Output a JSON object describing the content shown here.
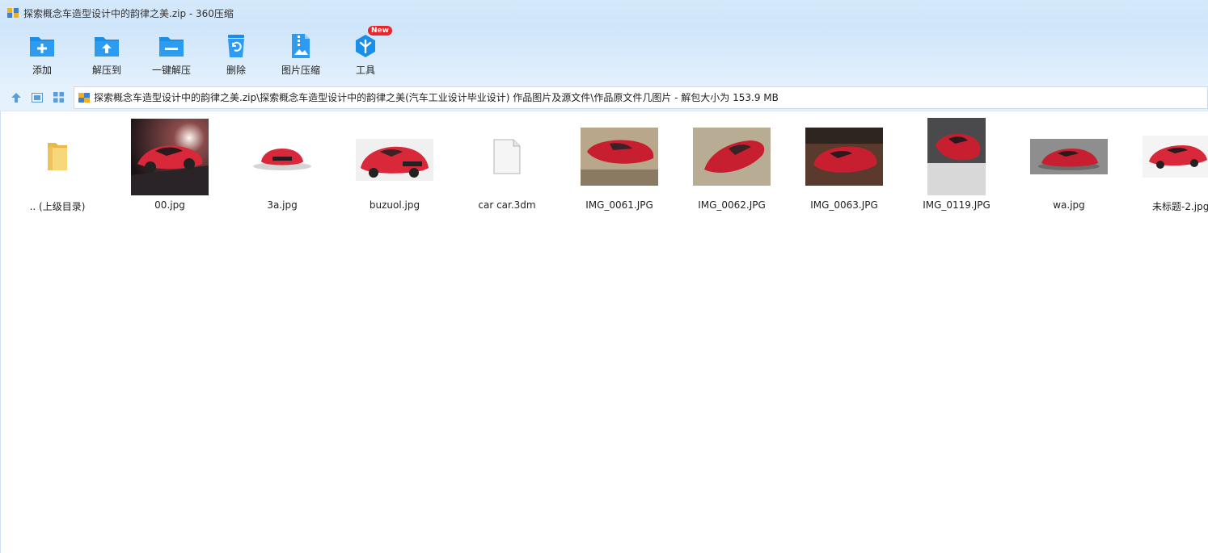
{
  "window": {
    "title": "探索概念车造型设计中的韵律之美.zip - 360压缩"
  },
  "toolbar": {
    "items": [
      {
        "label": "添加",
        "icon": "add-folder-icon"
      },
      {
        "label": "解压到",
        "icon": "extract-to-icon"
      },
      {
        "label": "一键解压",
        "icon": "one-click-extract-icon"
      },
      {
        "label": "删除",
        "icon": "recycle-bin-icon"
      },
      {
        "label": "图片压缩",
        "icon": "image-compress-icon"
      },
      {
        "label": "工具",
        "icon": "tools-icon",
        "badge": "New"
      }
    ]
  },
  "address": {
    "path": "探索概念车造型设计中的韵律之美.zip\\探索概念车造型设计中的韵律之美(汽车工业设计毕业设计)  作品图片及源文件\\作品原文件几图片 - 解包大小为 153.9 MB"
  },
  "files": [
    {
      "name": ".. (上级目录)",
      "kind": "folder"
    },
    {
      "name": "00.jpg",
      "kind": "image"
    },
    {
      "name": "3a.jpg",
      "kind": "image"
    },
    {
      "name": "buzuol.jpg",
      "kind": "image"
    },
    {
      "name": "car car.3dm",
      "kind": "document"
    },
    {
      "name": "IMG_0061.JPG",
      "kind": "image"
    },
    {
      "name": "IMG_0062.JPG",
      "kind": "image"
    },
    {
      "name": "IMG_0063.JPG",
      "kind": "image"
    },
    {
      "name": "IMG_0119.JPG",
      "kind": "image"
    },
    {
      "name": "wa.jpg",
      "kind": "image"
    },
    {
      "name": "未标题-2.jpg",
      "kind": "image"
    }
  ],
  "colors": {
    "accent": "#1a8fe8",
    "car_red": "#d8283a",
    "titlebar": "#d5e9fb",
    "badge": "#e8262c"
  }
}
